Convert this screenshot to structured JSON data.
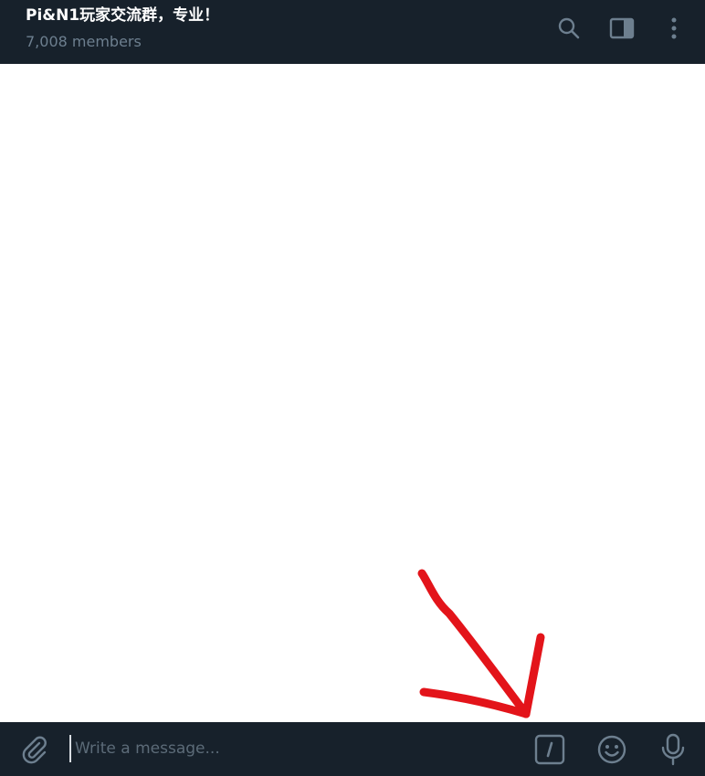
{
  "header": {
    "title": "Pi&N1玩家交流群，专业！",
    "subtitle": "7,008 members",
    "icons": {
      "search": "search-icon",
      "sidebar": "sidebar-toggle-icon",
      "more": "more-vertical-icon"
    }
  },
  "composer": {
    "placeholder": "Write a message...",
    "value": "",
    "icons": {
      "attach": "paperclip-icon",
      "commands": "bot-commands-icon",
      "emoji": "emoji-icon",
      "voice": "microphone-icon"
    },
    "commands_glyph": "/"
  },
  "colors": {
    "header_bg": "#17212b",
    "icon_color": "#6d7f8f",
    "annotation_arrow": "#e3141a"
  }
}
